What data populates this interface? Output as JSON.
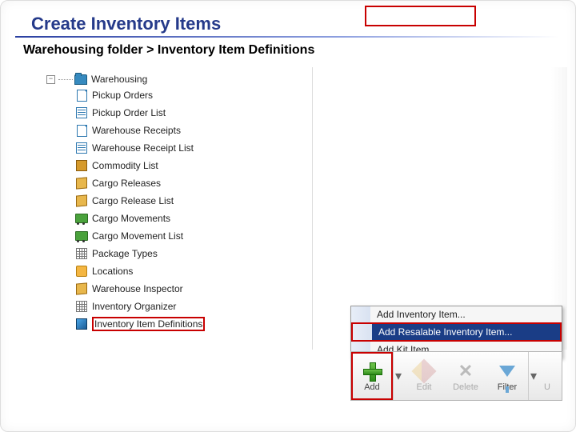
{
  "header": {
    "title": "Create Inventory Items",
    "breadcrumb": "Warehousing folder > Inventory Item Definitions"
  },
  "tree": {
    "root": "Warehousing",
    "items": [
      {
        "label": "Pickup Orders",
        "icon": "doc"
      },
      {
        "label": "Pickup Order List",
        "icon": "list"
      },
      {
        "label": "Warehouse Receipts",
        "icon": "doc"
      },
      {
        "label": "Warehouse Receipt List",
        "icon": "list"
      },
      {
        "label": "Commodity List",
        "icon": "pack"
      },
      {
        "label": "Cargo Releases",
        "icon": "box"
      },
      {
        "label": "Cargo Release List",
        "icon": "box"
      },
      {
        "label": "Cargo Movements",
        "icon": "truck"
      },
      {
        "label": "Cargo Movement List",
        "icon": "truck"
      },
      {
        "label": "Package Types",
        "icon": "grid"
      },
      {
        "label": "Locations",
        "icon": "loc"
      },
      {
        "label": "Warehouse Inspector",
        "icon": "box"
      },
      {
        "label": "Inventory Organizer",
        "icon": "grid"
      },
      {
        "label": "Inventory Item Definitions",
        "icon": "cube",
        "highlighted": true
      }
    ]
  },
  "context_menu": {
    "items": [
      {
        "label": "Add Inventory Item...",
        "selected": false
      },
      {
        "label": "Add Resalable Inventory Item...",
        "selected": true
      },
      {
        "label": "Add Kit Item...",
        "selected": false
      }
    ]
  },
  "toolbar": {
    "add": "Add",
    "edit": "Edit",
    "delete": "Delete",
    "filter": "Filter",
    "trailing": "U"
  },
  "colors": {
    "accent": "#c80000",
    "link": "#253a8a",
    "selection": "#1a3d86"
  }
}
